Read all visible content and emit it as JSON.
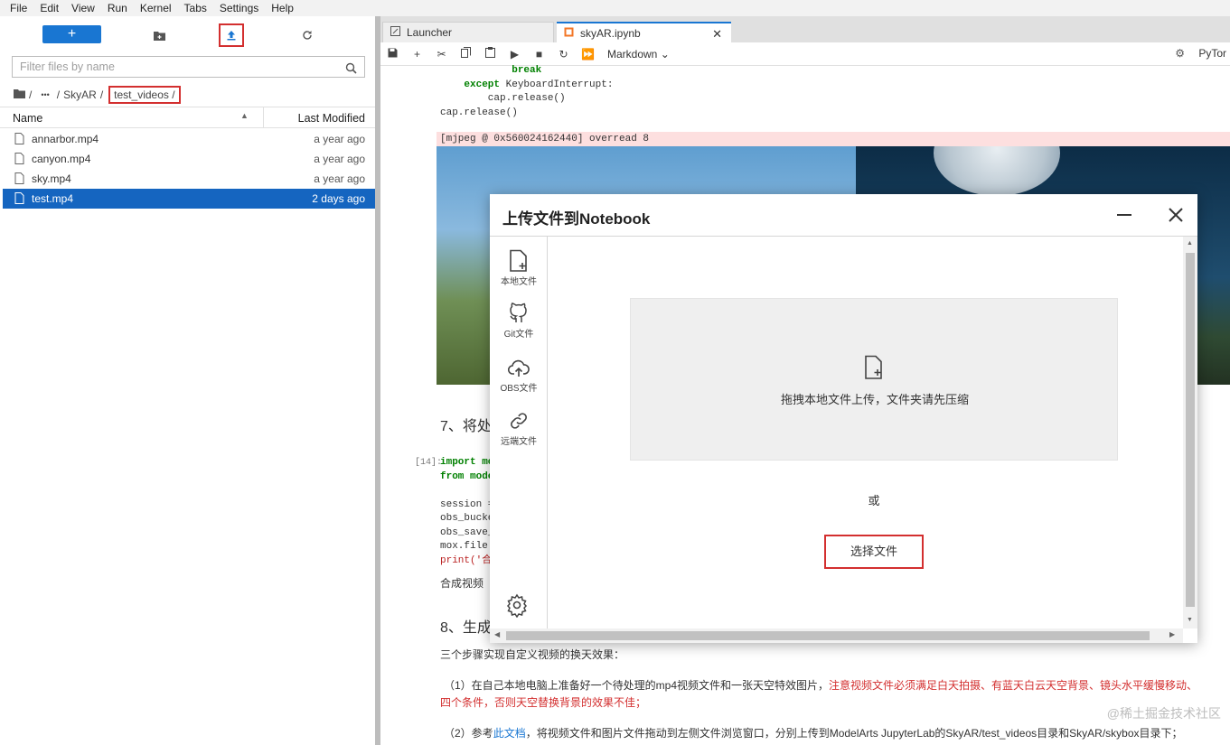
{
  "menu": [
    "File",
    "Edit",
    "View",
    "Run",
    "Kernel",
    "Tabs",
    "Settings",
    "Help"
  ],
  "filebrowser": {
    "new_label": "+",
    "filter_placeholder": "Filter files by name",
    "breadcrumb": {
      "root": "/",
      "ellipsis": "•••",
      "sep1": "/",
      "folder1": "SkyAR",
      "sep2": "/",
      "folder2": "test_videos /"
    },
    "col_name": "Name",
    "col_modified": "Last Modified",
    "files": [
      {
        "name": "annarbor.mp4",
        "modified": "a year ago"
      },
      {
        "name": "canyon.mp4",
        "modified": "a year ago"
      },
      {
        "name": "sky.mp4",
        "modified": "a year ago"
      },
      {
        "name": "test.mp4",
        "modified": "2 days ago"
      }
    ]
  },
  "tabs": [
    {
      "label": "Launcher"
    },
    {
      "label": "skyAR.ipynb"
    }
  ],
  "notebook": {
    "cell_type": "Markdown",
    "kernel": "PyTor",
    "code_top": [
      "            break",
      "    except KeyboardInterrupt:",
      "        cap.release()",
      "cap.release()"
    ],
    "error_line": "[mjpeg @ 0x560024162440] overread 8",
    "heading7": "7、将处",
    "prompt14": "[14]:",
    "code14": [
      "import mo",
      "from mode",
      "",
      "session =",
      "obs_bucke",
      "obs_save_",
      "mox.file.",
      "print('合"
    ],
    "out14": "合成视频",
    "heading8": "8、生成",
    "para1": "三个步骤实现自定义视频的换天效果：",
    "para2a": "（1）在自己本地电脑上准备好一个待处理的mp4视频文件和一张天空特效图片，",
    "para2b": "注意视频文件必须满足白天拍摄、有蓝天白云天空背景、镜头水平缓慢移动、",
    "para2c": "四个条件，否则天空替换背景的效果不佳；",
    "para3a": "（2）参考",
    "para3b": "此文档",
    "para3c": "，将视频文件和图片文件拖动到左侧文件浏览窗口，分别上传到ModelArts JupyterLab的SkyAR/test_videos目录和SkyAR/skybox目录下；"
  },
  "modal": {
    "title": "上传文件到Notebook",
    "side": [
      {
        "label": "本地文件"
      },
      {
        "label": "Git文件"
      },
      {
        "label": "OBS文件"
      },
      {
        "label": "远端文件"
      }
    ],
    "drop_text": "拖拽本地文件上传，文件夹请先压缩",
    "or_text": "或",
    "choose_label": "选择文件"
  },
  "watermark": "@稀土掘金技术社区",
  "colors": {
    "accent": "#1976d2",
    "highlight": "#d32f2f",
    "selected_row": "#1565c0"
  }
}
